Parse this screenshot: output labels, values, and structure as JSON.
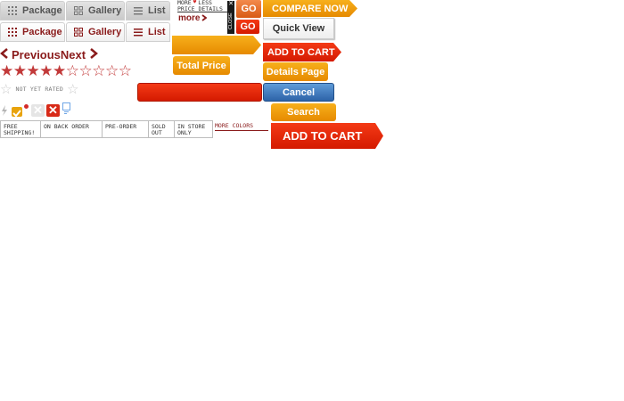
{
  "view_tabs": {
    "row1": [
      "Package",
      "Gallery",
      "List"
    ],
    "row2": [
      "Package",
      "Gallery",
      "List"
    ]
  },
  "pager": {
    "previous": "Previous",
    "next": "Next"
  },
  "rating": {
    "filled": 5,
    "total": 10,
    "not_rated": "NOT YET RATED"
  },
  "price_details": {
    "more": "MORE",
    "less": "LESS",
    "label": "PRICE DETAILS",
    "more_link": "more",
    "close": "CLOSE"
  },
  "go_buttons": [
    "GO",
    "GO"
  ],
  "status_labels": [
    "FREE SHIPPING!",
    "ON BACK ORDER",
    "PRE-ORDER",
    "SOLD OUT",
    "IN STORE ONLY"
  ],
  "more_colors": "MORE COLORS",
  "buttons": {
    "compare_now": "COMPARE NOW",
    "quick_view": "Quick View",
    "add_to_cart_small": "ADD TO CART",
    "total_price": "Total Price",
    "details_page": "Details Page",
    "cancel": "Cancel",
    "search": "Search",
    "add_to_cart_large": "ADD TO CART"
  },
  "colors": {
    "dark_red": "#8a1b1b",
    "orange": "#e68a00",
    "red": "#e02a0a",
    "blue": "#3a72b8"
  }
}
